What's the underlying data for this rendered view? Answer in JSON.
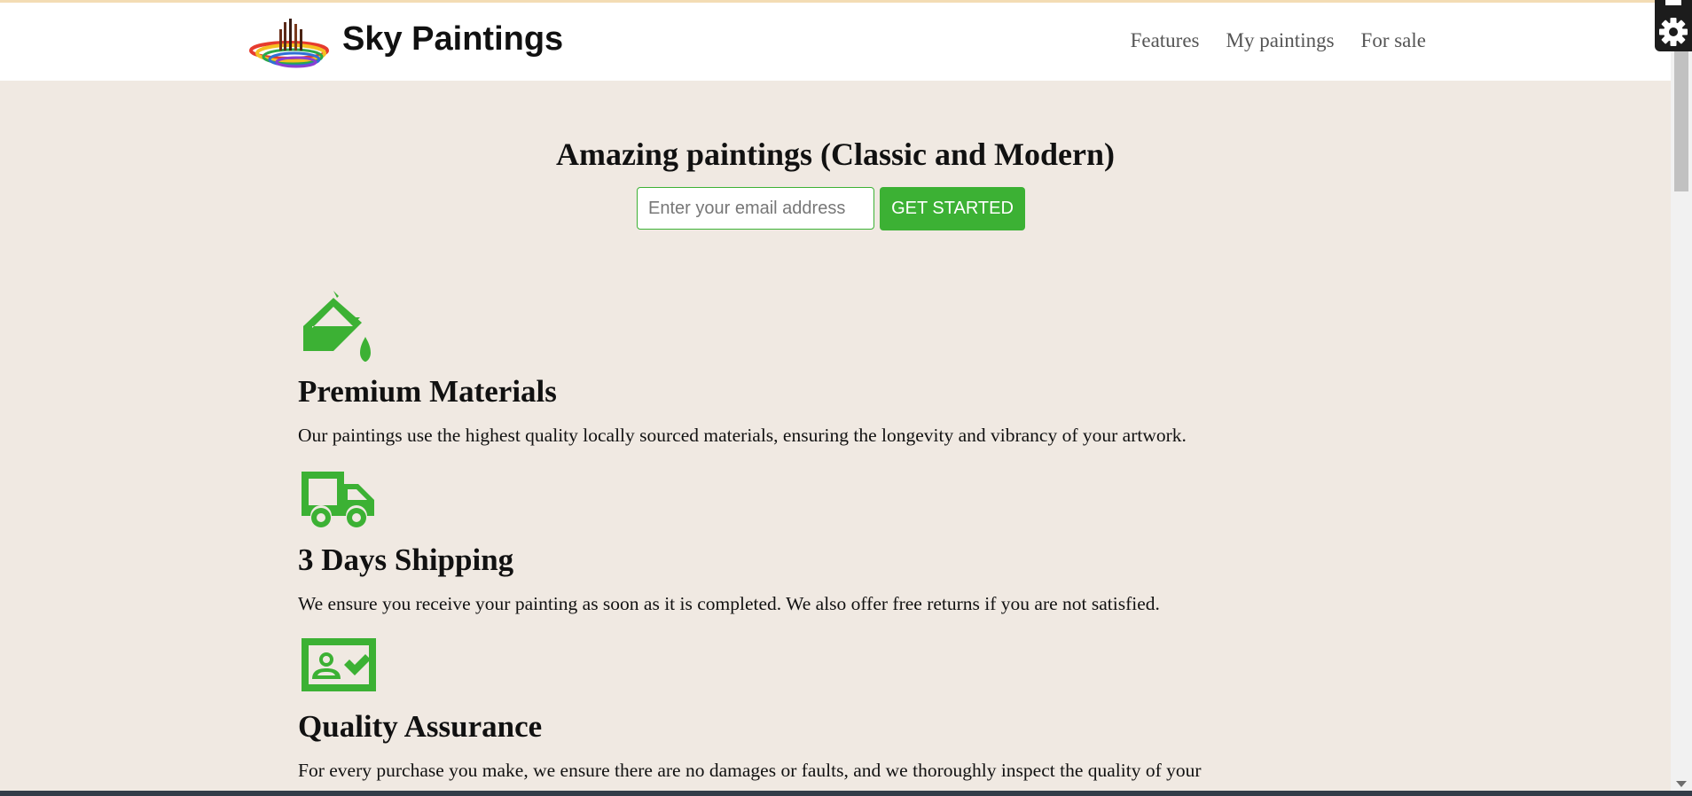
{
  "header": {
    "brand": "Sky Paintings",
    "nav": [
      "Features",
      "My paintings",
      "For sale"
    ]
  },
  "hero": {
    "title": "Amazing paintings (Classic and Modern)",
    "email_placeholder": "Enter your email address",
    "cta_label": "GET STARTED"
  },
  "features": [
    {
      "icon": "paint-bucket-icon",
      "title": "Premium Materials",
      "text": "Our paintings use the highest quality locally sourced materials, ensuring the longevity and vibrancy of your artwork."
    },
    {
      "icon": "truck-icon",
      "title": "3 Days Shipping",
      "text": "We ensure you receive your painting as soon as it is completed. We also offer free returns if you are not satisfied."
    },
    {
      "icon": "verified-id-icon",
      "title": "Quality Assurance",
      "text": "For every purchase you make, we ensure there are no damages or faults, and we thoroughly inspect the quality of your"
    }
  ],
  "colors": {
    "accent": "#3cb134",
    "background": "#f0e9e2",
    "header": "#ffffff"
  }
}
